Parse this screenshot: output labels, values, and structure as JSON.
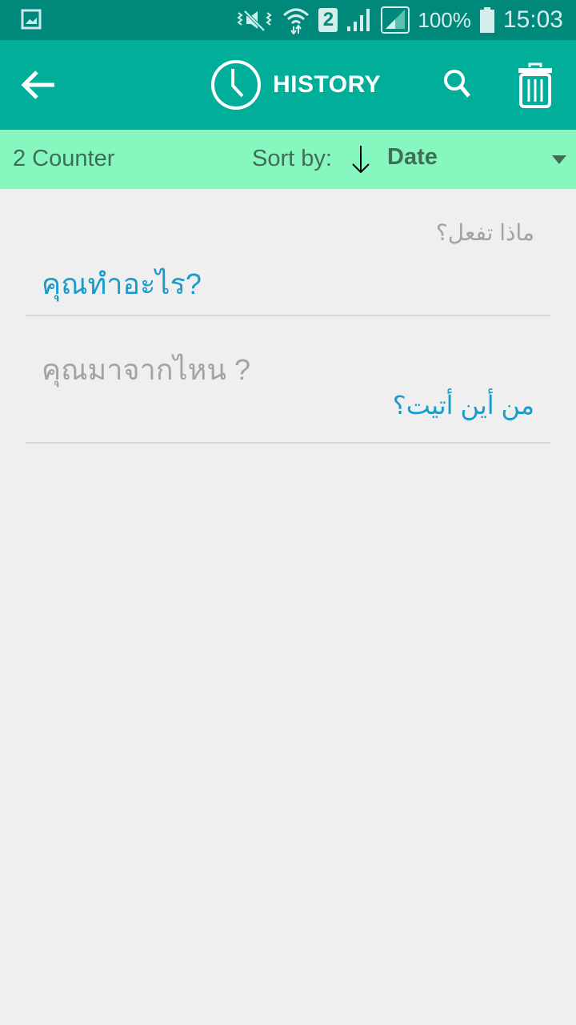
{
  "status_bar": {
    "battery_percent": "100%",
    "time": "15:03",
    "sim_slot": "2",
    "icons": [
      "gallery-notification-icon",
      "vibrate-mute-icon",
      "wifi-icon",
      "sim-2-icon",
      "signal-icon",
      "signal-icon-2",
      "battery-icon"
    ]
  },
  "app_bar": {
    "title": "HISTORY",
    "back_icon": "arrow-left-icon",
    "title_icon": "clock-icon",
    "search_icon": "search-icon",
    "delete_icon": "trash-icon"
  },
  "sort_bar": {
    "counter": "2 Counter",
    "sort_label": "Sort by:",
    "sort_direction_icon": "arrow-down-icon",
    "sort_value": "Date",
    "dropdown_icon": "triangle-down-icon"
  },
  "history": [
    {
      "source": "ماذا تفعل؟",
      "translation": "คุณทำอะไร?"
    },
    {
      "source": "คุณมาจากไหน ?",
      "translation": "من أين أتيت؟"
    }
  ],
  "colors": {
    "status_bar": "#00897b",
    "app_bar": "#00ae9a",
    "sort_bar": "#86f8bf",
    "accent_text": "#1a9ccb",
    "muted_text": "#a3a3a3"
  }
}
